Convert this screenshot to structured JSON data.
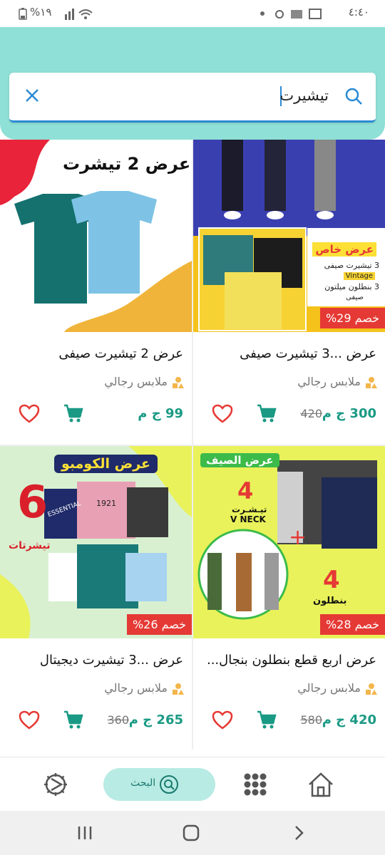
{
  "status_bar": {
    "time": "٤:٤٠",
    "battery": "%١٩"
  },
  "search": {
    "query": "تيشيرت"
  },
  "products": [
    {
      "title": "عرض ...3 تيشيرت صيفى",
      "category": "ملابس رجالي",
      "price": "300 ج م",
      "old_price": "420",
      "discount": "خصم 29%",
      "image": {
        "banner_title": "عرض خاص",
        "line1": "3 تيشيرت صيفى",
        "line2": "Vintage",
        "line3": "3 بنطلون ميلتون",
        "line4": "صيفى"
      }
    },
    {
      "title": "عرض 2 تيشيرت صيفى",
      "category": "ملابس رجالي",
      "price": "99 ج م",
      "old_price": "",
      "discount": "",
      "image": {
        "banner_title": "عرض 2 تيشرت"
      }
    },
    {
      "title": "عرض اربع قطع بنطلون بنجال...",
      "category": "ملابس رجالي",
      "price": "420 ج م",
      "old_price": "580",
      "discount": "خصم 28%",
      "image": {
        "banner_title": "عرض الصيف",
        "num1": "4",
        "text1": "تيـشـرت",
        "text2": "V NECK",
        "num2": "4",
        "text3": "بنطلون"
      }
    },
    {
      "title": "عرض ...3 تيشيرت ديجيتال",
      "category": "ملابس رجالي",
      "price": "265 ج م",
      "old_price": "360",
      "discount": "خصم 26%",
      "image": {
        "banner_title": "عرض الكومبو",
        "num": "6",
        "text": "تيشرتات",
        "shirt1": "ESSENTIAL",
        "shirt2": "1921"
      }
    }
  ],
  "bottom_nav": {
    "search_label": "البحث"
  },
  "colors": {
    "header": "#8fe0d6",
    "accent": "#1a9a84",
    "discount": "#e53935",
    "heart": "#e53935"
  }
}
